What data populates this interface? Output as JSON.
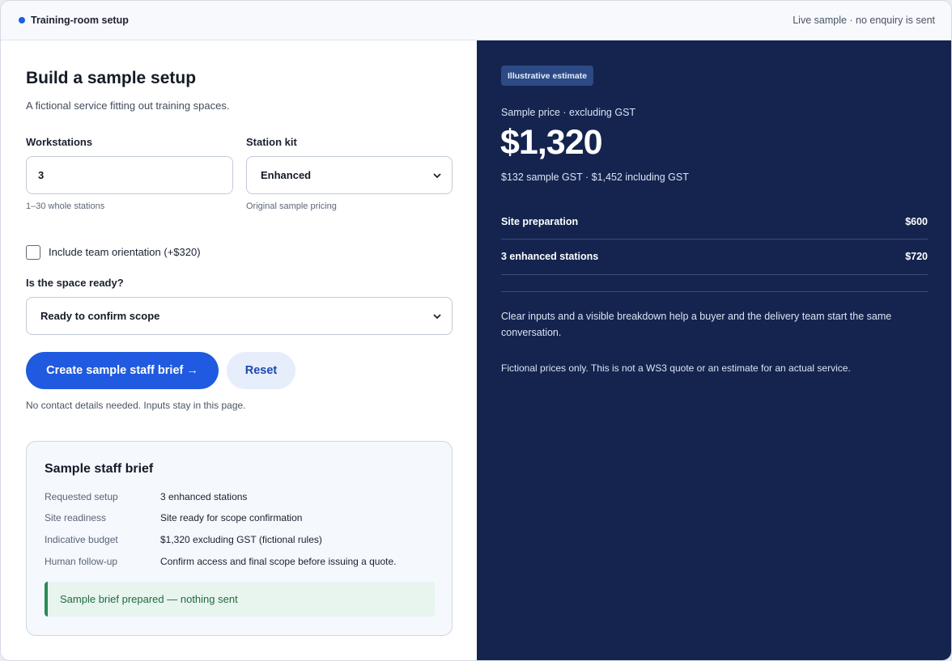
{
  "header": {
    "title": "Training-room setup",
    "note": "Live sample · no enquiry is sent"
  },
  "form": {
    "title": "Build a sample setup",
    "subtitle": "A fictional service fitting out training spaces.",
    "workstations": {
      "label": "Workstations",
      "value": "3",
      "hint": "1–30 whole stations"
    },
    "station_kit": {
      "label": "Station kit",
      "value": "Enhanced",
      "hint": "Original sample pricing"
    },
    "orientation": {
      "label": "Include team orientation (+$320)",
      "checked": false
    },
    "space_ready": {
      "label": "Is the space ready?",
      "value": "Ready to confirm scope"
    },
    "primary_button": "Create sample staff brief →",
    "reset_button": "Reset",
    "privacy_note": "No contact details needed. Inputs stay in this page."
  },
  "brief": {
    "title": "Sample staff brief",
    "rows": [
      {
        "key": "Requested setup",
        "value": "3 enhanced stations"
      },
      {
        "key": "Site readiness",
        "value": "Site ready for scope confirmation"
      },
      {
        "key": "Indicative budget",
        "value": "$1,320 excluding GST (fictional rules)"
      },
      {
        "key": "Human follow-up",
        "value": "Confirm access and final scope before issuing a quote."
      }
    ],
    "status": "Sample brief prepared — nothing sent"
  },
  "estimate": {
    "badge": "Illustrative estimate",
    "price_label": "Sample price · excluding GST",
    "price": "$1,320",
    "price_sub": "$132 sample GST · $1,452 including GST",
    "lines": [
      {
        "label": "Site preparation",
        "amount": "$600"
      },
      {
        "label": "3 enhanced stations",
        "amount": "$720"
      }
    ],
    "explanation": "Clear inputs and a visible breakdown help a buyer and the delivery team start the same conversation.",
    "disclaimer": "Fictional prices only. This is not a WS3 quote or an estimate for an actual service."
  },
  "colors": {
    "accent": "#1f5ae0",
    "panel": "#14244f",
    "success": "#2b8a58"
  }
}
